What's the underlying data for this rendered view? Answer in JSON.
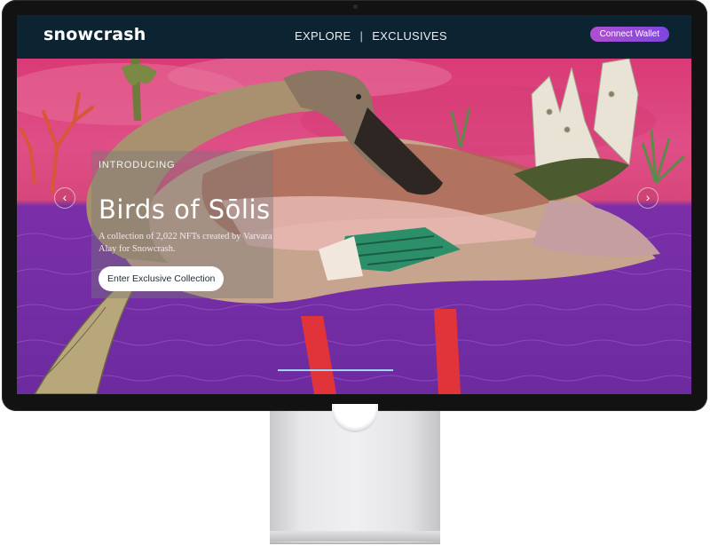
{
  "header": {
    "logo": "snowcrash",
    "nav": [
      {
        "label": "EXPLORE"
      },
      {
        "label": "EXCLUSIVES"
      }
    ],
    "nav_separator": "|",
    "connect_wallet": "Connect Wallet"
  },
  "hero": {
    "eyebrow": "INTRODUCING",
    "title": "Birds of Sōlis",
    "description": "A collection of 2,022 NFTs created by Varvara Alay for Snowcrash.",
    "cta": "Enter Exclusive Collection",
    "prev_icon": "chevron-left-icon",
    "next_icon": "chevron-right-icon",
    "slide_progress": 1.0
  },
  "colors": {
    "header_bg": "#0c2331",
    "accent_gradient_start": "#b04fd0",
    "accent_gradient_end": "#7e46de",
    "sky_pink": "#d93a76",
    "water_purple": "#6d2ba0",
    "indicator": "#9fd7f4"
  }
}
